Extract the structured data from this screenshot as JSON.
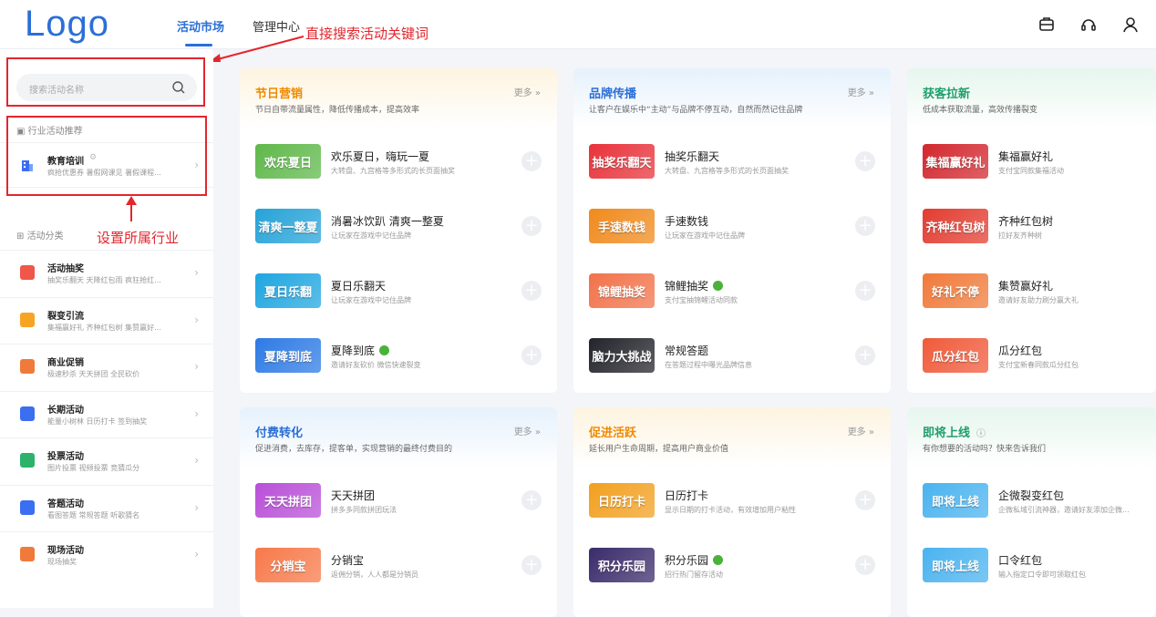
{
  "header": {
    "logo": "Logo",
    "tabs": [
      {
        "label": "活动市场"
      },
      {
        "label": "管理中心"
      }
    ]
  },
  "annotations": {
    "search": "直接搜索活动关键词",
    "industry": "设置所属行业"
  },
  "sidebar": {
    "search_placeholder": "搜索活动名称",
    "industry_title": "行业活动推荐",
    "industry": {
      "title": "教育培训",
      "sub": "疯抢优惠券 暑假网课见 暑假课程..."
    },
    "category_title": "活动分类",
    "items": [
      {
        "title": "活动抽奖",
        "sub": "抽奖乐翻天  天降红包雨  疯狂抢红...",
        "color": "#f0564a"
      },
      {
        "title": "裂变引流",
        "sub": "集福赢好礼  齐种红包树  集赞赢好...",
        "color": "#f5a523"
      },
      {
        "title": "商业促销",
        "sub": "极速秒杀  天天拼团  全民砍价",
        "color": "#f07a3a"
      },
      {
        "title": "长期活动",
        "sub": "能量小树林  日历打卡  签到抽奖",
        "color": "#3b6ef0"
      },
      {
        "title": "投票活动",
        "sub": "图片投票  视频投票  竞猜瓜分",
        "color": "#2bb36b"
      },
      {
        "title": "答题活动",
        "sub": "看图答题  常规答题  听歌猜名",
        "color": "#3b6ef0"
      },
      {
        "title": "现场活动",
        "sub": "现场抽奖",
        "color": "#f07a3a"
      }
    ]
  },
  "cards": [
    {
      "title": "节日营销",
      "sub": "节日自带流量属性，降低传播成本，提高效率",
      "more": "更多",
      "title_color": "#f08a00",
      "bg": "#fdf4e0",
      "rows": [
        {
          "title": "欢乐夏日，嗨玩一夏",
          "sub": "大转盘、九宫格等多形式的长页面抽奖",
          "thumb": "欢乐夏日",
          "tc": "#5fb84a",
          "badge": false
        },
        {
          "title": "消暑冰饮趴 清爽一整夏",
          "sub": "让玩家在游戏中记住品牌",
          "thumb": "清爽一整夏",
          "tc": "#26a3d8",
          "badge": false
        },
        {
          "title": "夏日乐翻天",
          "sub": "让玩家在游戏中记住品牌",
          "thumb": "夏日乐翻",
          "tc": "#1fa6e0",
          "badge": false
        },
        {
          "title": "夏降到底",
          "sub": "邀请好友砍价 微信快速裂变",
          "thumb": "夏降到底",
          "tc": "#2d7ae5",
          "badge": true
        }
      ]
    },
    {
      "title": "品牌传播",
      "sub": "让客户在娱乐中“主动”与品牌不停互动，自然而然记住品牌",
      "more": "更多",
      "title_color": "#2b6fd6",
      "bg": "#e6f1fc",
      "rows": [
        {
          "title": "抽奖乐翻天",
          "sub": "大转盘、九宫格等多形式的长页面抽奖",
          "thumb": "抽奖乐翻天",
          "tc": "#e8323a",
          "badge": false
        },
        {
          "title": "手速数钱",
          "sub": "让玩家在游戏中记住品牌",
          "thumb": "手速数钱",
          "tc": "#f08a1c",
          "badge": false
        },
        {
          "title": "锦鲤抽奖",
          "sub": "支付宝抽锦鲤活动同款",
          "thumb": "锦鲤抽奖",
          "tc": "#f2724a",
          "badge": true
        },
        {
          "title": "常规答题",
          "sub": "在答题过程中曝光品牌信息",
          "thumb": "脑力大挑战",
          "tc": "#23232b",
          "badge": false
        }
      ]
    },
    {
      "title": "获客拉新",
      "sub": "低成本获取流量，高效传播裂变",
      "more": "",
      "title_color": "#1e9e6a",
      "bg": "#e6f6ee",
      "rows": [
        {
          "title": "集福赢好礼",
          "sub": "支付宝同款集福活动",
          "thumb": "集福赢好礼",
          "tc": "#d2282e",
          "badge": false
        },
        {
          "title": "齐种红包树",
          "sub": "拉好友齐种树",
          "thumb": "齐种红包树",
          "tc": "#e33c30",
          "badge": false
        },
        {
          "title": "集赞赢好礼",
          "sub": "邀请好友助力刷分赢大礼",
          "thumb": "好礼不停",
          "tc": "#f07a3a",
          "badge": false
        },
        {
          "title": "瓜分红包",
          "sub": "支付宝新春同款瓜分红包",
          "thumb": "瓜分红包",
          "tc": "#f05a3a",
          "badge": false
        }
      ]
    },
    {
      "title": "付费转化",
      "sub": "促进消费，去库存，提客单，实现营销的最终付费目的",
      "more": "更多",
      "title_color": "#2b6fd6",
      "bg": "#e6f1fc",
      "rows": [
        {
          "title": "天天拼团",
          "sub": "拼多多同款拼团玩法",
          "thumb": "天天拼团",
          "tc": "#b94fd8",
          "badge": false
        },
        {
          "title": "分销宝",
          "sub": "返佣分销，人人都是分销员",
          "thumb": "分销宝",
          "tc": "#f7794a",
          "badge": false
        }
      ]
    },
    {
      "title": "促进活跃",
      "sub": "延长用户生命周期，提高用户商业价值",
      "more": "更多",
      "title_color": "#f08a00",
      "bg": "#fdf4e0",
      "rows": [
        {
          "title": "日历打卡",
          "sub": "显示日期的打卡活动，有效增加用户粘性",
          "thumb": "日历打卡",
          "tc": "#f2a01f",
          "badge": false
        },
        {
          "title": "积分乐园",
          "sub": "招行热门留存活动",
          "thumb": "积分乐园",
          "tc": "#3a2b6b",
          "badge": true
        }
      ]
    },
    {
      "title": "即将上线",
      "sub": "有你想要的活动吗？快来告诉我们",
      "more": "",
      "title_color": "#1e9e6a",
      "bg": "#e6f6ee",
      "rows": [
        {
          "title": "企微裂变红包",
          "sub": "企微私域引流神器，邀请好友添加企微...",
          "thumb": "即将上线",
          "tc": "#4ab3ef",
          "badge": false
        },
        {
          "title": "口令红包",
          "sub": "输入指定口令即可领取红包",
          "thumb": "即将上线",
          "tc": "#4ab3ef",
          "badge": false
        }
      ]
    }
  ]
}
